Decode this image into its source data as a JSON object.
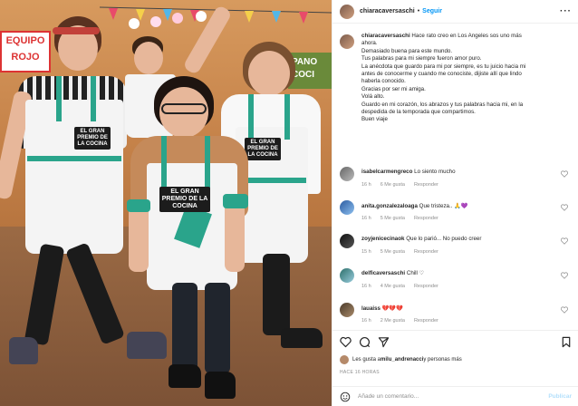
{
  "photo": {
    "sign_left_line1": "EQUIPO",
    "sign_left_line2": "ROJO",
    "sign_right": "PANO COCI",
    "apron_label": "EL GRAN PREMIO DE LA COCINA"
  },
  "header": {
    "username": "chiaracaversaschi",
    "separator": "•",
    "follow_label": "Seguir",
    "more_label": "···"
  },
  "caption": {
    "username": "chiaracaversaschi",
    "lines": [
      "Hace rato creo en Los Angeles sos uno más",
      "ahora.",
      "Demasiado buena para este mundo.",
      "Tus palabras para mi siempre fueron amor puro.",
      "La anécdota que guardo para mi por siempre, es tu juicio hacia mi",
      "antes de conocerme y cuando me conociste, dijiste allí que lindo",
      "haberla conocido.",
      "Gracias por ser mi amiga.",
      "Volá alto.",
      "Guardo en mi corazón, los abrazos y tus palabras hacia mi, en la",
      "despedida de la temporada que compartimos.",
      "Buen viaje"
    ]
  },
  "comments": [
    {
      "user": "isabelcarmengreco",
      "text": "Lo siento mucho",
      "time": "16 h",
      "likes": "6 Me gusta",
      "reply": "Responder"
    },
    {
      "user": "anita.gonzalezaloaga",
      "text": "Que tristeza.. 🙏💜",
      "time": "16 h",
      "likes": "5 Me gusta",
      "reply": "Responder"
    },
    {
      "user": "zoyjenicecinaok",
      "text": "Que lo parió... No puedo creer",
      "time": "15 h",
      "likes": "5 Me gusta",
      "reply": "Responder"
    },
    {
      "user": "delficaversaschi",
      "text": "Chill ♡",
      "time": "16 h",
      "likes": "4 Me gusta",
      "reply": "Responder"
    },
    {
      "user": "lauaiss",
      "text": "💔💔💔",
      "time": "16 h",
      "likes": "2 Me gusta",
      "reply": "Responder"
    }
  ],
  "likes": {
    "prefix": "Les gusta a ",
    "user": "milu_andrenacci",
    "suffix": " y personas más"
  },
  "timeago": "HACE 16 HORAS",
  "add_comment": {
    "placeholder": "Añade un comentario...",
    "publish_label": "Publicar"
  },
  "colors": {
    "follow": "#0095f6",
    "strap": "#2aa48b",
    "meta": "#8e8e8e"
  }
}
